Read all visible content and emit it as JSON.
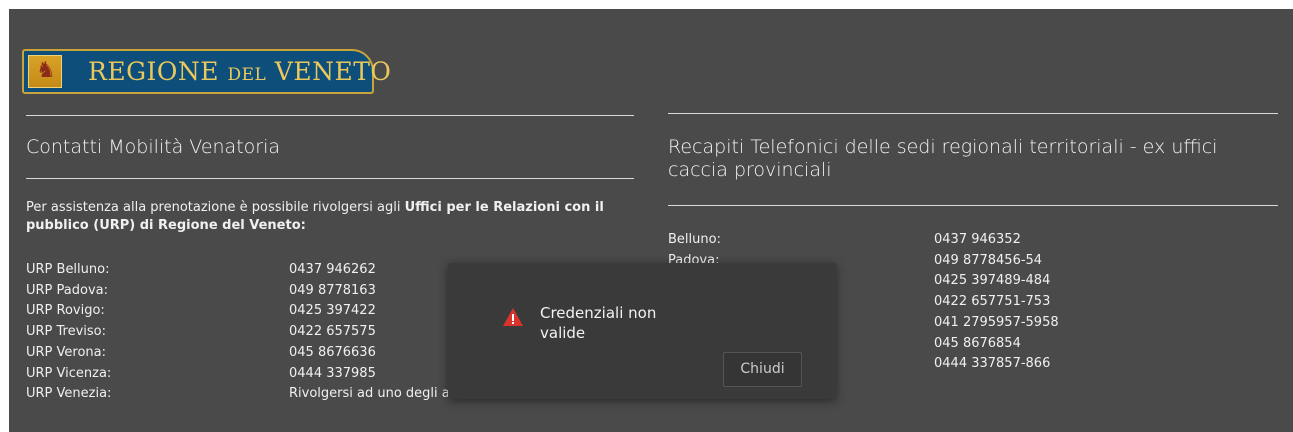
{
  "logo": {
    "text_main1": "REGIONE ",
    "text_small": "DEL",
    "text_main2": " VENETO"
  },
  "left": {
    "title": "Contatti Mobilità Venatoria",
    "intro_plain": "Per assistenza alla prenotazione è possibile rivolgersi agli ",
    "intro_bold": "Uffici per le Relazioni con il pubblico (URP) di Regione del Veneto:",
    "rows": [
      {
        "label": "URP Belluno:",
        "value": "0437 946262"
      },
      {
        "label": "URP Padova:",
        "value": "049 8778163"
      },
      {
        "label": "URP Rovigo:",
        "value": "0425 397422"
      },
      {
        "label": "URP Treviso:",
        "value": "0422 657575"
      },
      {
        "label": "URP Verona:",
        "value": "045 8676636"
      },
      {
        "label": "URP Vicenza:",
        "value": "0444 337985"
      },
      {
        "label": "URP Venezia:",
        "value": "Rivolgersi ad uno degli al"
      }
    ]
  },
  "right": {
    "title": "Recapiti Telefonici delle sedi regionali territoriali - ex uffici caccia provinciali",
    "rows": [
      {
        "label": "Belluno:",
        "value": "0437 946352"
      },
      {
        "label": "Padova:",
        "value": "049 8778456-54"
      },
      {
        "label": "",
        "value": "0425 397489-484"
      },
      {
        "label": "",
        "value": "0422 657751-753"
      },
      {
        "label": "",
        "value": "041 2795957-5958"
      },
      {
        "label": "",
        "value": "045 8676854"
      },
      {
        "label": "",
        "value": "0444 337857-866"
      }
    ]
  },
  "modal": {
    "message": "Credenziali non valide",
    "close_label": "Chiudi",
    "icon": "warning-triangle-icon"
  },
  "colors": {
    "background": "#4a4a4a",
    "modal": "#3a3a3a",
    "warning": "#d9342b",
    "logo_blue": "#0e4e7a",
    "logo_gold": "#e9c85d"
  }
}
